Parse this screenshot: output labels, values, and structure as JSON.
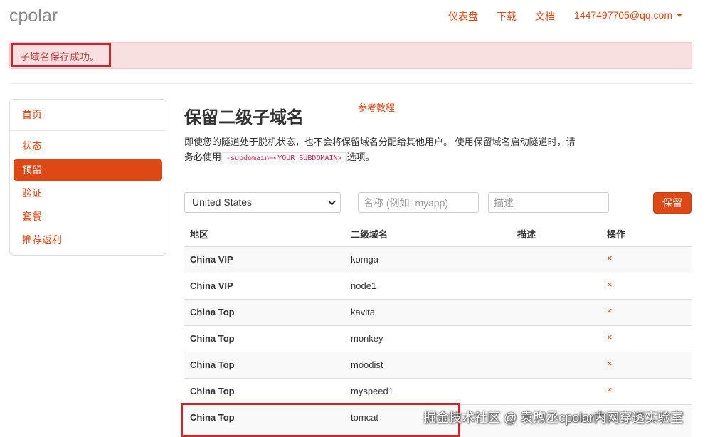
{
  "brand": "cpolar",
  "nav": {
    "dashboard": "仪表盘",
    "download": "下载",
    "docs": "文档",
    "account": "1447497705@qq.com"
  },
  "alert": {
    "message": "子域名保存成功。"
  },
  "sidebar": {
    "items": [
      {
        "label": "首页"
      },
      {
        "label": "状态"
      },
      {
        "label": "预留",
        "active": true
      },
      {
        "label": "验证"
      },
      {
        "label": "套餐"
      },
      {
        "label": "推荐返利"
      }
    ]
  },
  "main": {
    "title": "保留二级子域名",
    "tutorial_link": "参考教程",
    "description_before": "即使您的隧道处于脱机状态，也不会将保留域名分配给其他用户。 使用保留域名启动隧道时，请务必使用",
    "description_code": "-subdomain=<YOUR_SUBDOMAIN>",
    "description_after": "选项。"
  },
  "form": {
    "region_selected": "United States",
    "name_placeholder": "名称 (例如: myapp)",
    "desc_placeholder": "描述",
    "save_label": "保留"
  },
  "table": {
    "headers": {
      "region": "地区",
      "subdomain": "二级域名",
      "description": "描述",
      "action": "操作"
    },
    "delete_symbol": "×",
    "rows": [
      {
        "region": "China VIP",
        "subdomain": "komga",
        "description": ""
      },
      {
        "region": "China VIP",
        "subdomain": "node1",
        "description": ""
      },
      {
        "region": "China Top",
        "subdomain": "kavita",
        "description": ""
      },
      {
        "region": "China Top",
        "subdomain": "monkey",
        "description": ""
      },
      {
        "region": "China Top",
        "subdomain": "moodist",
        "description": ""
      },
      {
        "region": "China Top",
        "subdomain": "myspeed1",
        "description": ""
      },
      {
        "region": "China Top",
        "subdomain": "tomcat",
        "description": ""
      }
    ]
  },
  "watermark": "掘金技术社区 @ 袁煦丞cpolar内网穿透实验室",
  "colors": {
    "accent": "#dd4814",
    "alert_bg": "#f9e0e0",
    "alert_text": "#b94a48",
    "highlight": "#d2232a"
  }
}
